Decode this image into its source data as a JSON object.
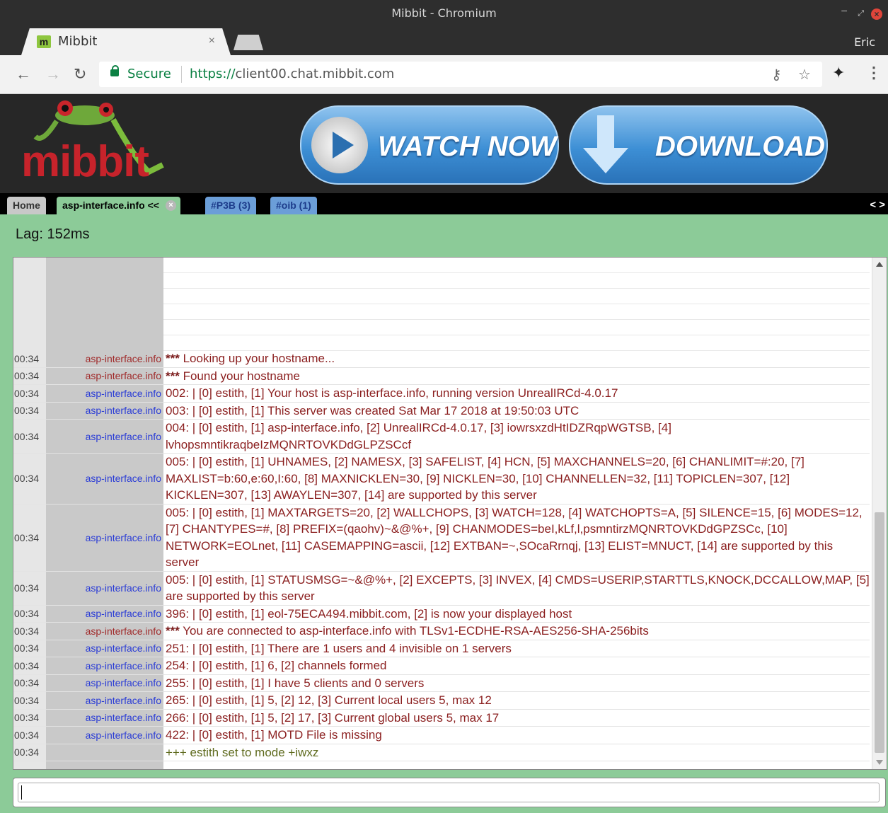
{
  "window": {
    "title": "Mibbit - Chromium"
  },
  "browser": {
    "tab_label": "Mibbit",
    "tab_favicon": "m",
    "tab_close": "×",
    "profile": "Eric",
    "secure_label": "Secure",
    "url_scheme": "https://",
    "url_host": "client00.chat.mibbit.com"
  },
  "banner": {
    "logo": "mibbit",
    "watch_label": "WATCH NOW",
    "download_label": "DOWNLOAD"
  },
  "mibbit_tabs": [
    {
      "label": "Home"
    },
    {
      "label": "asp-interface.info <<"
    },
    {
      "label": "#P3B (3)"
    },
    {
      "label": "#oib (1)"
    }
  ],
  "mibbit_tabs_scroll": "< >",
  "status": {
    "lag": "Lag: 152ms"
  },
  "messages": [
    {
      "time": "00:34",
      "nick": "asp-interface.info",
      "nick_color": "red",
      "prefix": "***",
      "text": " Looking up your hostname..."
    },
    {
      "time": "00:34",
      "nick": "asp-interface.info",
      "nick_color": "red",
      "prefix": "***",
      "text": " Found your hostname"
    },
    {
      "time": "00:34",
      "nick": "asp-interface.info",
      "nick_color": "blue",
      "prefix": "",
      "text": "002:  | [0] estith, [1] Your host is asp-interface.info, running version UnrealIRCd-4.0.17"
    },
    {
      "time": "00:34",
      "nick": "asp-interface.info",
      "nick_color": "blue",
      "prefix": "",
      "text": "003:  | [0] estith, [1] This server was created Sat Mar 17 2018 at 19:50:03 UTC"
    },
    {
      "time": "00:34",
      "nick": "asp-interface.info",
      "nick_color": "blue",
      "prefix": "",
      "text": "004:  | [0] estith, [1] asp-interface.info, [2] UnrealIRCd-4.0.17, [3] iowrsxzdHtIDZRqpWGTSB, [4] lvhopsmntikraqbeIzMQNRTOVKDdGLPZSCcf"
    },
    {
      "time": "00:34",
      "nick": "asp-interface.info",
      "nick_color": "blue",
      "prefix": "",
      "text": "005:  | [0] estith, [1] UHNAMES, [2] NAMESX, [3] SAFELIST, [4] HCN, [5] MAXCHANNELS=20, [6] CHANLIMIT=#:20, [7] MAXLIST=b:60,e:60,I:60, [8] MAXNICKLEN=30, [9] NICKLEN=30, [10] CHANNELLEN=32, [11] TOPICLEN=307, [12] KICKLEN=307, [13] AWAYLEN=307, [14] are supported by this server"
    },
    {
      "time": "00:34",
      "nick": "asp-interface.info",
      "nick_color": "blue",
      "prefix": "",
      "text": "005:  | [0] estith, [1] MAXTARGETS=20, [2] WALLCHOPS, [3] WATCH=128, [4] WATCHOPTS=A, [5] SILENCE=15, [6] MODES=12, [7] CHANTYPES=#, [8] PREFIX=(qaohv)~&@%+, [9] CHANMODES=beI,kLf,l,psmntirzMQNRTOVKDdGPZSCc, [10] NETWORK=EOLnet, [11] CASEMAPPING=ascii, [12] EXTBAN=~,SOcaRrnqj, [13] ELIST=MNUCT, [14] are supported by this server"
    },
    {
      "time": "00:34",
      "nick": "asp-interface.info",
      "nick_color": "blue",
      "prefix": "",
      "text": "005:  | [0] estith, [1] STATUSMSG=~&@%+, [2] EXCEPTS, [3] INVEX, [4] CMDS=USERIP,STARTTLS,KNOCK,DCCALLOW,MAP, [5] are supported by this server"
    },
    {
      "time": "00:34",
      "nick": "asp-interface.info",
      "nick_color": "blue",
      "prefix": "",
      "text": "396:  | [0] estith, [1] eol-75ECA494.mibbit.com, [2] is now your displayed host"
    },
    {
      "time": "00:34",
      "nick": "asp-interface.info",
      "nick_color": "red",
      "prefix": "***",
      "text": " You are connected to asp-interface.info with TLSv1-ECDHE-RSA-AES256-SHA-256bits"
    },
    {
      "time": "00:34",
      "nick": "asp-interface.info",
      "nick_color": "blue",
      "prefix": "",
      "text": "251:  | [0] estith, [1] There are 1 users and 4 invisible on 1 servers"
    },
    {
      "time": "00:34",
      "nick": "asp-interface.info",
      "nick_color": "blue",
      "prefix": "",
      "text": "254:  | [0] estith, [1] 6, [2] channels formed"
    },
    {
      "time": "00:34",
      "nick": "asp-interface.info",
      "nick_color": "blue",
      "prefix": "",
      "text": "255:  | [0] estith, [1] I have 5 clients and 0 servers"
    },
    {
      "time": "00:34",
      "nick": "asp-interface.info",
      "nick_color": "blue",
      "prefix": "",
      "text": "265:  | [0] estith, [1] 5, [2] 12, [3] Current local users 5, max 12"
    },
    {
      "time": "00:34",
      "nick": "asp-interface.info",
      "nick_color": "blue",
      "prefix": "",
      "text": "266:  | [0] estith, [1] 5, [2] 17, [3] Current global users 5, max 17"
    },
    {
      "time": "00:34",
      "nick": "asp-interface.info",
      "nick_color": "blue",
      "prefix": "",
      "text": "422:  | [0] estith, [1] MOTD File is missing"
    },
    {
      "time": "00:34",
      "nick": "",
      "nick_color": "blue",
      "prefix": "",
      "text": "+++ estith set to mode +iwxz",
      "style": "green"
    }
  ],
  "input": {
    "value": "",
    "placeholder": ""
  }
}
